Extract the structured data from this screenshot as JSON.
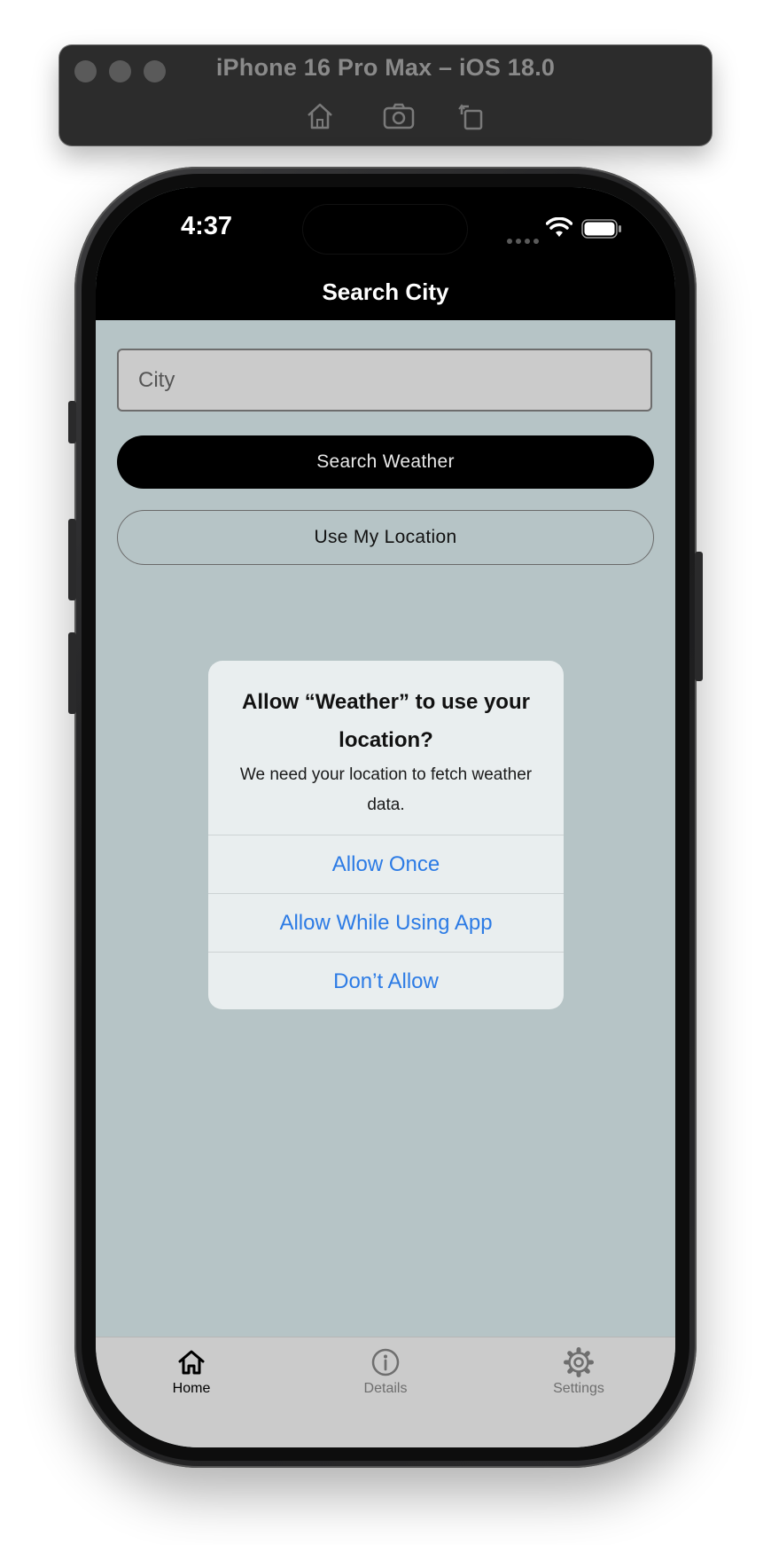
{
  "simulator": {
    "title": "iPhone 16 Pro Max – iOS 18.0",
    "tools": [
      "home-icon",
      "screenshot-icon",
      "rotate-icon"
    ]
  },
  "status_bar": {
    "time": "4:37",
    "icons": [
      "signal-dots-icon",
      "wifi-icon",
      "battery-icon"
    ]
  },
  "nav": {
    "title": "Search City"
  },
  "search": {
    "city_value": "",
    "city_placeholder": "City",
    "search_button": "Search Weather",
    "location_button": "Use My Location"
  },
  "alert": {
    "title": "Allow “Weather” to use your location?",
    "message": "We need your location to fetch weather data.",
    "actions": [
      "Allow Once",
      "Allow While Using App",
      "Don’t Allow"
    ],
    "action_color": "#2c7be5"
  },
  "tabs": [
    {
      "label": "Home",
      "icon": "home-icon",
      "active": true
    },
    {
      "label": "Details",
      "icon": "info-icon",
      "active": false
    },
    {
      "label": "Settings",
      "icon": "gear-icon",
      "active": false
    }
  ],
  "colors": {
    "screen_background": "#b6c4c6",
    "nav_background": "#000000",
    "tab_bar_background": "#cbcbcb"
  }
}
